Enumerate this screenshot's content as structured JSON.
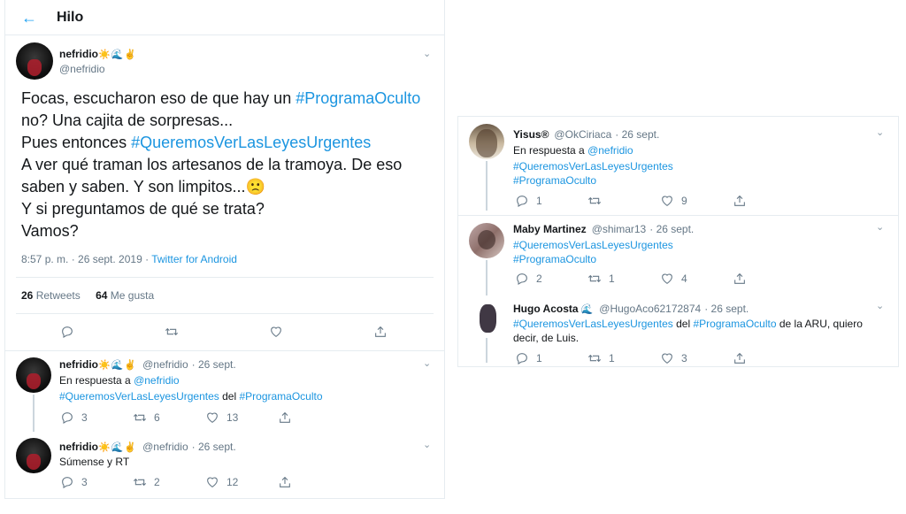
{
  "header": {
    "back_icon": "arrow-left-icon",
    "title": "Hilo"
  },
  "main_tweet": {
    "name": "nefridio",
    "emojis": "☀️🌊✌️",
    "handle": "@nefridio",
    "lines": [
      {
        "pre": "Focas, escucharon eso de que hay un ",
        "tag": "#ProgramaOculto",
        "post": ""
      },
      {
        "pre": " no? Una cajita de sorpresas...",
        "tag": "",
        "post": ""
      },
      {
        "pre": "Pues entonces ",
        "tag": "#QueremosVerLasLeyesUrgentes",
        "post": ""
      },
      {
        "pre": "A ver qué traman los artesanos de la tramoya. De eso",
        "tag": "",
        "post": ""
      },
      {
        "pre": "saben y saben. Y son limpitos...",
        "tag": "",
        "post": "🙁"
      },
      {
        "pre": "Y si preguntamos de qué se trata?",
        "tag": "",
        "post": ""
      },
      {
        "pre": "Vamos?",
        "tag": "",
        "post": ""
      }
    ],
    "time": "8:57 p. m. · 26 sept. 2019 · ",
    "source": "Twitter for Android",
    "retweets_count": "26",
    "retweets_label": "Retweets",
    "likes_count": "64",
    "likes_label": "Me gusta"
  },
  "replies_left": [
    {
      "name": "nefridio",
      "emojis": "☀️🌊✌️",
      "handle": "@nefridio",
      "date": "· 26 sept.",
      "reply_prefix": "En respuesta a ",
      "reply_to": "@nefridio",
      "tag1": "#QueremosVerLasLeyesUrgentes",
      "mid": " del ",
      "tag2": "#ProgramaOculto",
      "replies": "3",
      "retweets": "6",
      "likes": "13"
    },
    {
      "name": "nefridio",
      "emojis": "☀️🌊✌️",
      "handle": "@nefridio",
      "date": "· 26 sept.",
      "text": "Súmense y RT",
      "replies": "3",
      "retweets": "2",
      "likes": "12"
    }
  ],
  "replies_right": [
    {
      "name": "Yisus®",
      "handle": "@OkCiriaca",
      "date": "· 26 sept.",
      "reply_prefix": "En respuesta a ",
      "reply_to": "@nefridio",
      "tag1": "#QueremosVerLasLeyesUrgentes",
      "tag2": "#ProgramaOculto",
      "replies": "1",
      "retweets": "",
      "likes": "9"
    },
    {
      "name": "Maby Martinez",
      "handle": "@shimar13",
      "date": "· 26 sept.",
      "tag1": "#QueremosVerLasLeyesUrgentes",
      "tag2": "#ProgramaOculto",
      "replies": "2",
      "retweets": "1",
      "likes": "4"
    },
    {
      "name": "Hugo Acosta",
      "name_emoji": "🌊",
      "handle": "@HugoAco62172874",
      "date": "· 26 sept.",
      "tag1": "#QueremosVerLasLeyesUrgentes",
      "mid": " del ",
      "tag2": "#ProgramaOculto",
      "tail": " de la ARU, quiero",
      "line2": "decir, de Luis.",
      "replies": "1",
      "retweets": "1",
      "likes": "3"
    }
  ],
  "colors": {
    "accent": "#1b95e0",
    "muted": "#657786",
    "border": "#e6ecf0"
  }
}
